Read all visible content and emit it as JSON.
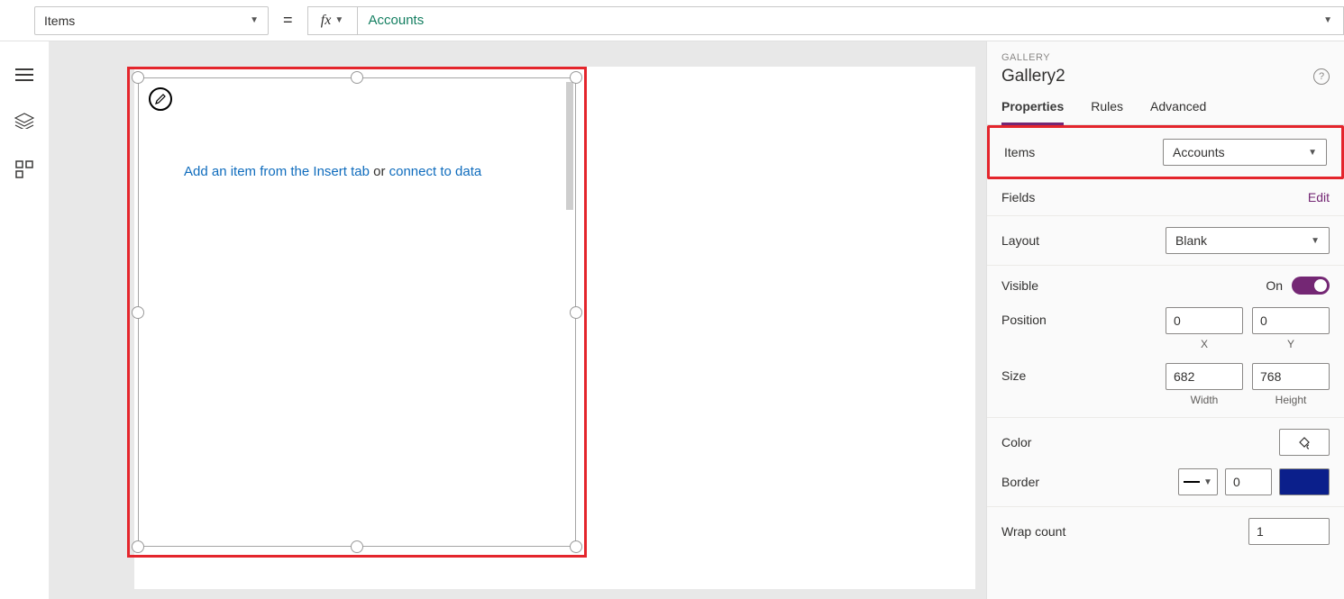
{
  "formula_bar": {
    "property": "Items",
    "fx_label": "fx",
    "value": "Accounts"
  },
  "canvas": {
    "hint_prefix": "Add an item from the Insert tab",
    "hint_mid": " or ",
    "hint_link": "connect to data"
  },
  "panel": {
    "type": "GALLERY",
    "name": "Gallery2",
    "tabs": {
      "properties": "Properties",
      "rules": "Rules",
      "advanced": "Advanced"
    },
    "items": {
      "label": "Items",
      "value": "Accounts"
    },
    "fields": {
      "label": "Fields",
      "edit": "Edit"
    },
    "layout": {
      "label": "Layout",
      "value": "Blank"
    },
    "visible": {
      "label": "Visible",
      "on": "On"
    },
    "position": {
      "label": "Position",
      "x": "0",
      "y": "0",
      "x_label": "X",
      "y_label": "Y"
    },
    "size": {
      "label": "Size",
      "w": "682",
      "h": "768",
      "w_label": "Width",
      "h_label": "Height"
    },
    "color": {
      "label": "Color"
    },
    "border": {
      "label": "Border",
      "value": "0",
      "color": "#0b1f8b"
    },
    "wrap": {
      "label": "Wrap count",
      "value": "1"
    }
  }
}
